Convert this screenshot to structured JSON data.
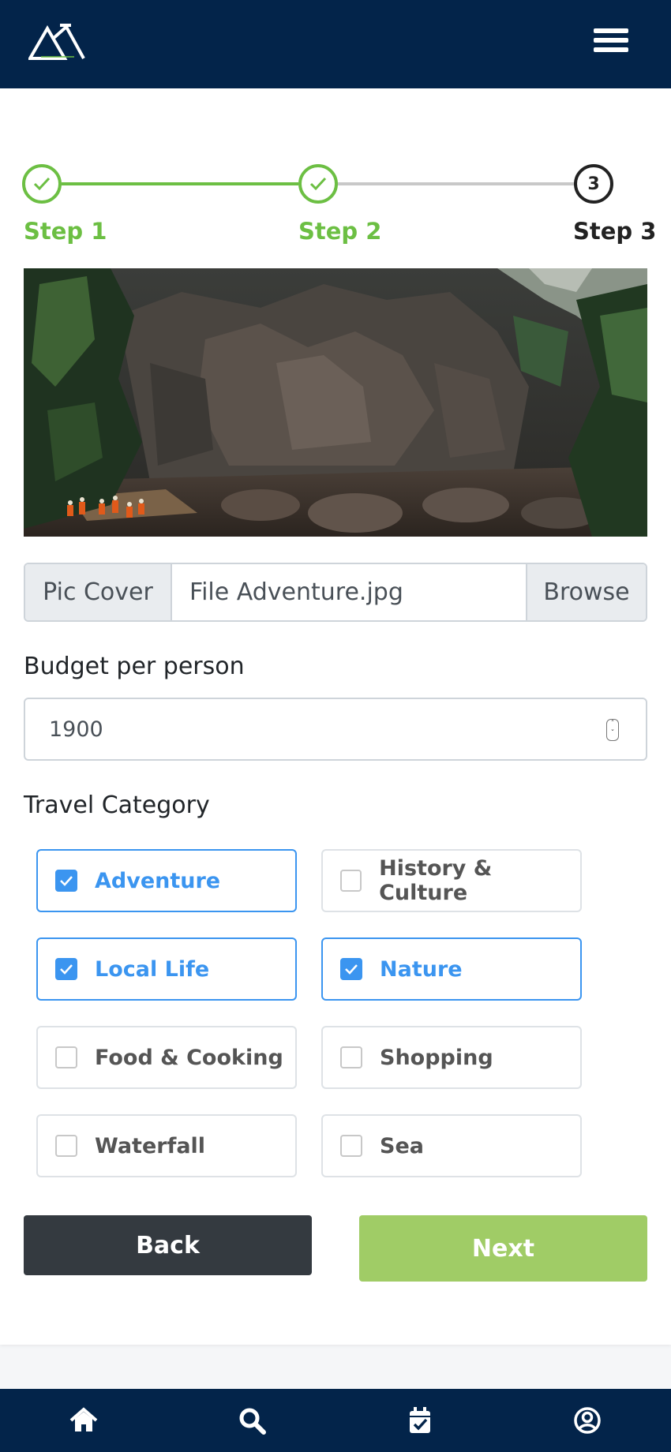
{
  "stepper": {
    "steps": [
      {
        "label": "Step 1",
        "state": "complete"
      },
      {
        "label": "Step 2",
        "state": "complete"
      },
      {
        "label": "Step 3",
        "state": "active",
        "number": "3"
      }
    ],
    "complete_color": "#6cbf43",
    "active_color": "#222222"
  },
  "cover_file": {
    "label": "Pic Cover",
    "value": "File Adventure.jpg",
    "browse_label": "Browse"
  },
  "budget": {
    "label": "Budget per person",
    "value": "1900"
  },
  "travel_category": {
    "label": "Travel Category",
    "options": [
      {
        "label": "Adventure",
        "checked": true
      },
      {
        "label": "History & Culture",
        "checked": false
      },
      {
        "label": "Local Life",
        "checked": true
      },
      {
        "label": "Nature",
        "checked": true
      },
      {
        "label": "Food & Cooking",
        "checked": false
      },
      {
        "label": "Shopping",
        "checked": false
      },
      {
        "label": "Waterfall",
        "checked": false
      },
      {
        "label": "Sea",
        "checked": false
      }
    ]
  },
  "actions": {
    "back_label": "Back",
    "next_label": "Next"
  },
  "bottom_nav": [
    "home-icon",
    "search-icon",
    "calendar-check-icon",
    "user-circle-icon"
  ],
  "colors": {
    "header_bg": "#03244a",
    "accent_blue": "#3b95f0",
    "next_button": "#a0cc66",
    "back_button": "#343a40"
  }
}
